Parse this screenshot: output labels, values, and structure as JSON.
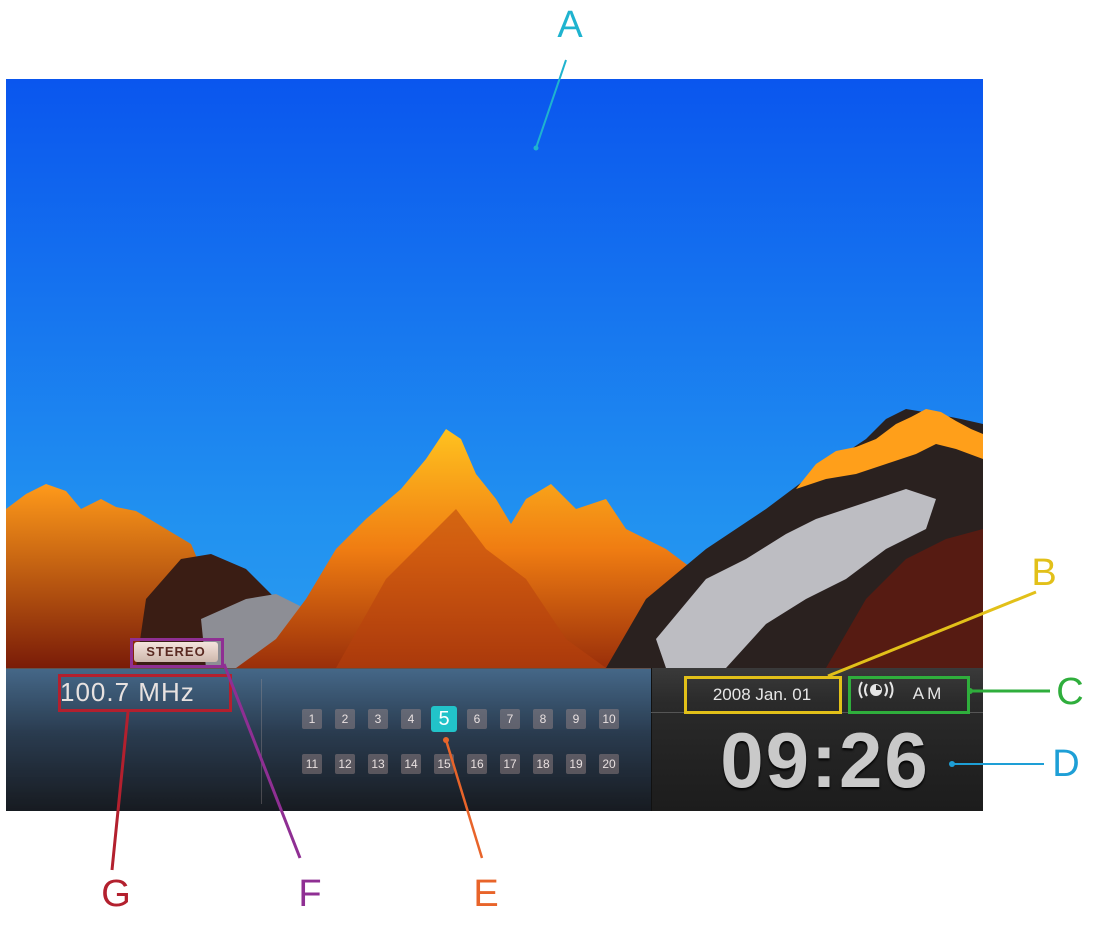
{
  "screen": {
    "radio": {
      "stereo_label": "STEREO",
      "frequency": "100.7 MHz"
    },
    "presets": {
      "row1": [
        "1",
        "2",
        "3",
        "4",
        "5",
        "6",
        "7",
        "8",
        "9",
        "10"
      ],
      "row2": [
        "11",
        "12",
        "13",
        "14",
        "15",
        "16",
        "17",
        "18",
        "19",
        "20"
      ],
      "selected": "5"
    },
    "date": "2008  Jan.  01",
    "alarm_icon": "alarm-radio-icon",
    "band": "AM",
    "time": "09:26"
  },
  "callouts": {
    "A": "A",
    "B": "B",
    "C": "C",
    "D": "D",
    "E": "E",
    "F": "F",
    "G": "G"
  },
  "colors": {
    "A": "#1fb3cf",
    "B": "#e2c019",
    "C": "#2fae3c",
    "D": "#1e9fd6",
    "E": "#e8642a",
    "F": "#8f2f93",
    "G": "#b3202e",
    "preset_active": "#22c3c9"
  }
}
